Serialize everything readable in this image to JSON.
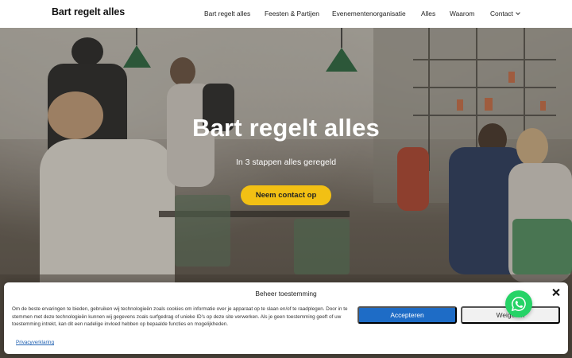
{
  "header": {
    "logo": "Bart regelt alles",
    "nav": [
      {
        "label": "Bart regelt alles"
      },
      {
        "label": "Feesten & Partijen"
      },
      {
        "label": "Evenementenorganisatie"
      },
      {
        "label": "Alles"
      },
      {
        "label": "Waarom"
      },
      {
        "label": "Contact"
      }
    ]
  },
  "hero": {
    "title": "Bart regelt alles",
    "subtitle": "In 3 stappen alles geregeld",
    "cta_label": "Neem contact op"
  },
  "cookie": {
    "title": "Beheer toestemming",
    "text": "Om de beste ervaringen te bieden, gebruiken wij technologieën zoals cookies om informatie over je apparaat op te slaan en/of te raadplegen. Door in te stemmen met deze technologieën kunnen wij gegevens zoals surfgedrag of unieke ID's op deze site verwerken. Als je geen toestemming geeft of uw toestemming intrekt, kan dit een nadelige invloed hebben op bepaalde functies en mogelijkheden.",
    "accept_label": "Accepteren",
    "deny_label": "Weigeren",
    "privacy_label": "Privacyverklaring"
  },
  "colors": {
    "accent": "#f2c014",
    "accept_button": "#1e6cc6",
    "whatsapp": "#25d366"
  },
  "icons": {
    "close": "close-icon",
    "whatsapp": "whatsapp-icon",
    "dropdown": "chevron-down-icon"
  }
}
